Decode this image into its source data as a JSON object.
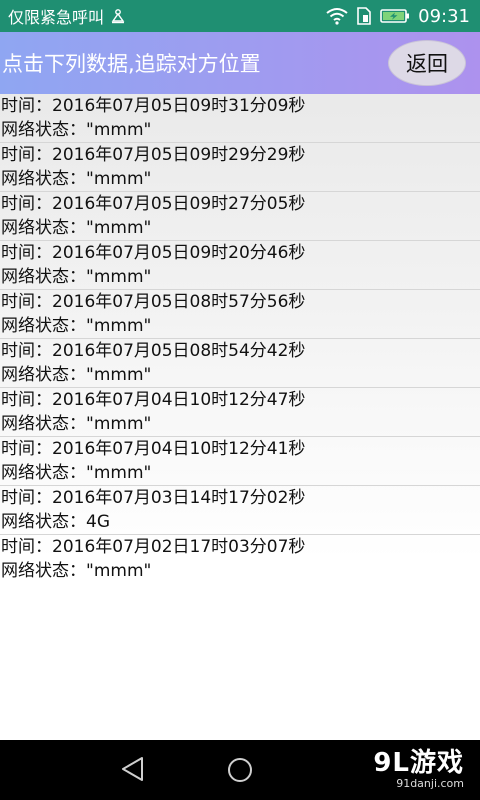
{
  "status_bar": {
    "carrier_text": "仅限紧急呼叫",
    "time": "09:31",
    "icons": [
      "sim-alert-icon",
      "wifi-icon",
      "sim-card-icon",
      "battery-charging-icon"
    ],
    "background_color": "#1f8f72"
  },
  "title_bar": {
    "title": "点击下列数据,追踪对方位置",
    "back_label": "返回",
    "gradient_start": "#8fa6f2",
    "gradient_end": "#ad92ee"
  },
  "records": [
    {
      "time_line": "时间：2016年07月05日09时31分09秒",
      "network_line": "网络状态：\"mmm\""
    },
    {
      "time_line": "时间：2016年07月05日09时29分29秒",
      "network_line": "网络状态：\"mmm\""
    },
    {
      "time_line": "时间：2016年07月05日09时27分05秒",
      "network_line": "网络状态：\"mmm\""
    },
    {
      "time_line": "时间：2016年07月05日09时20分46秒",
      "network_line": "网络状态：\"mmm\""
    },
    {
      "time_line": "时间：2016年07月05日08时57分56秒",
      "network_line": "网络状态：\"mmm\""
    },
    {
      "time_line": "时间：2016年07月05日08时54分42秒",
      "network_line": "网络状态：\"mmm\""
    },
    {
      "time_line": "时间：2016年07月04日10时12分47秒",
      "network_line": "网络状态：\"mmm\""
    },
    {
      "time_line": "时间：2016年07月04日10时12分41秒",
      "network_line": "网络状态：\"mmm\""
    },
    {
      "time_line": "时间：2016年07月03日14时17分02秒",
      "network_line": "网络状态：4G"
    },
    {
      "time_line": "时间：2016年07月02日17时03分07秒",
      "network_line": "网络状态：\"mmm\""
    }
  ],
  "nav_bar": {
    "icons": [
      "back-triangle-icon",
      "home-circle-icon"
    ],
    "watermark_logo": "9L游戏",
    "watermark_url": "91danji.com"
  }
}
